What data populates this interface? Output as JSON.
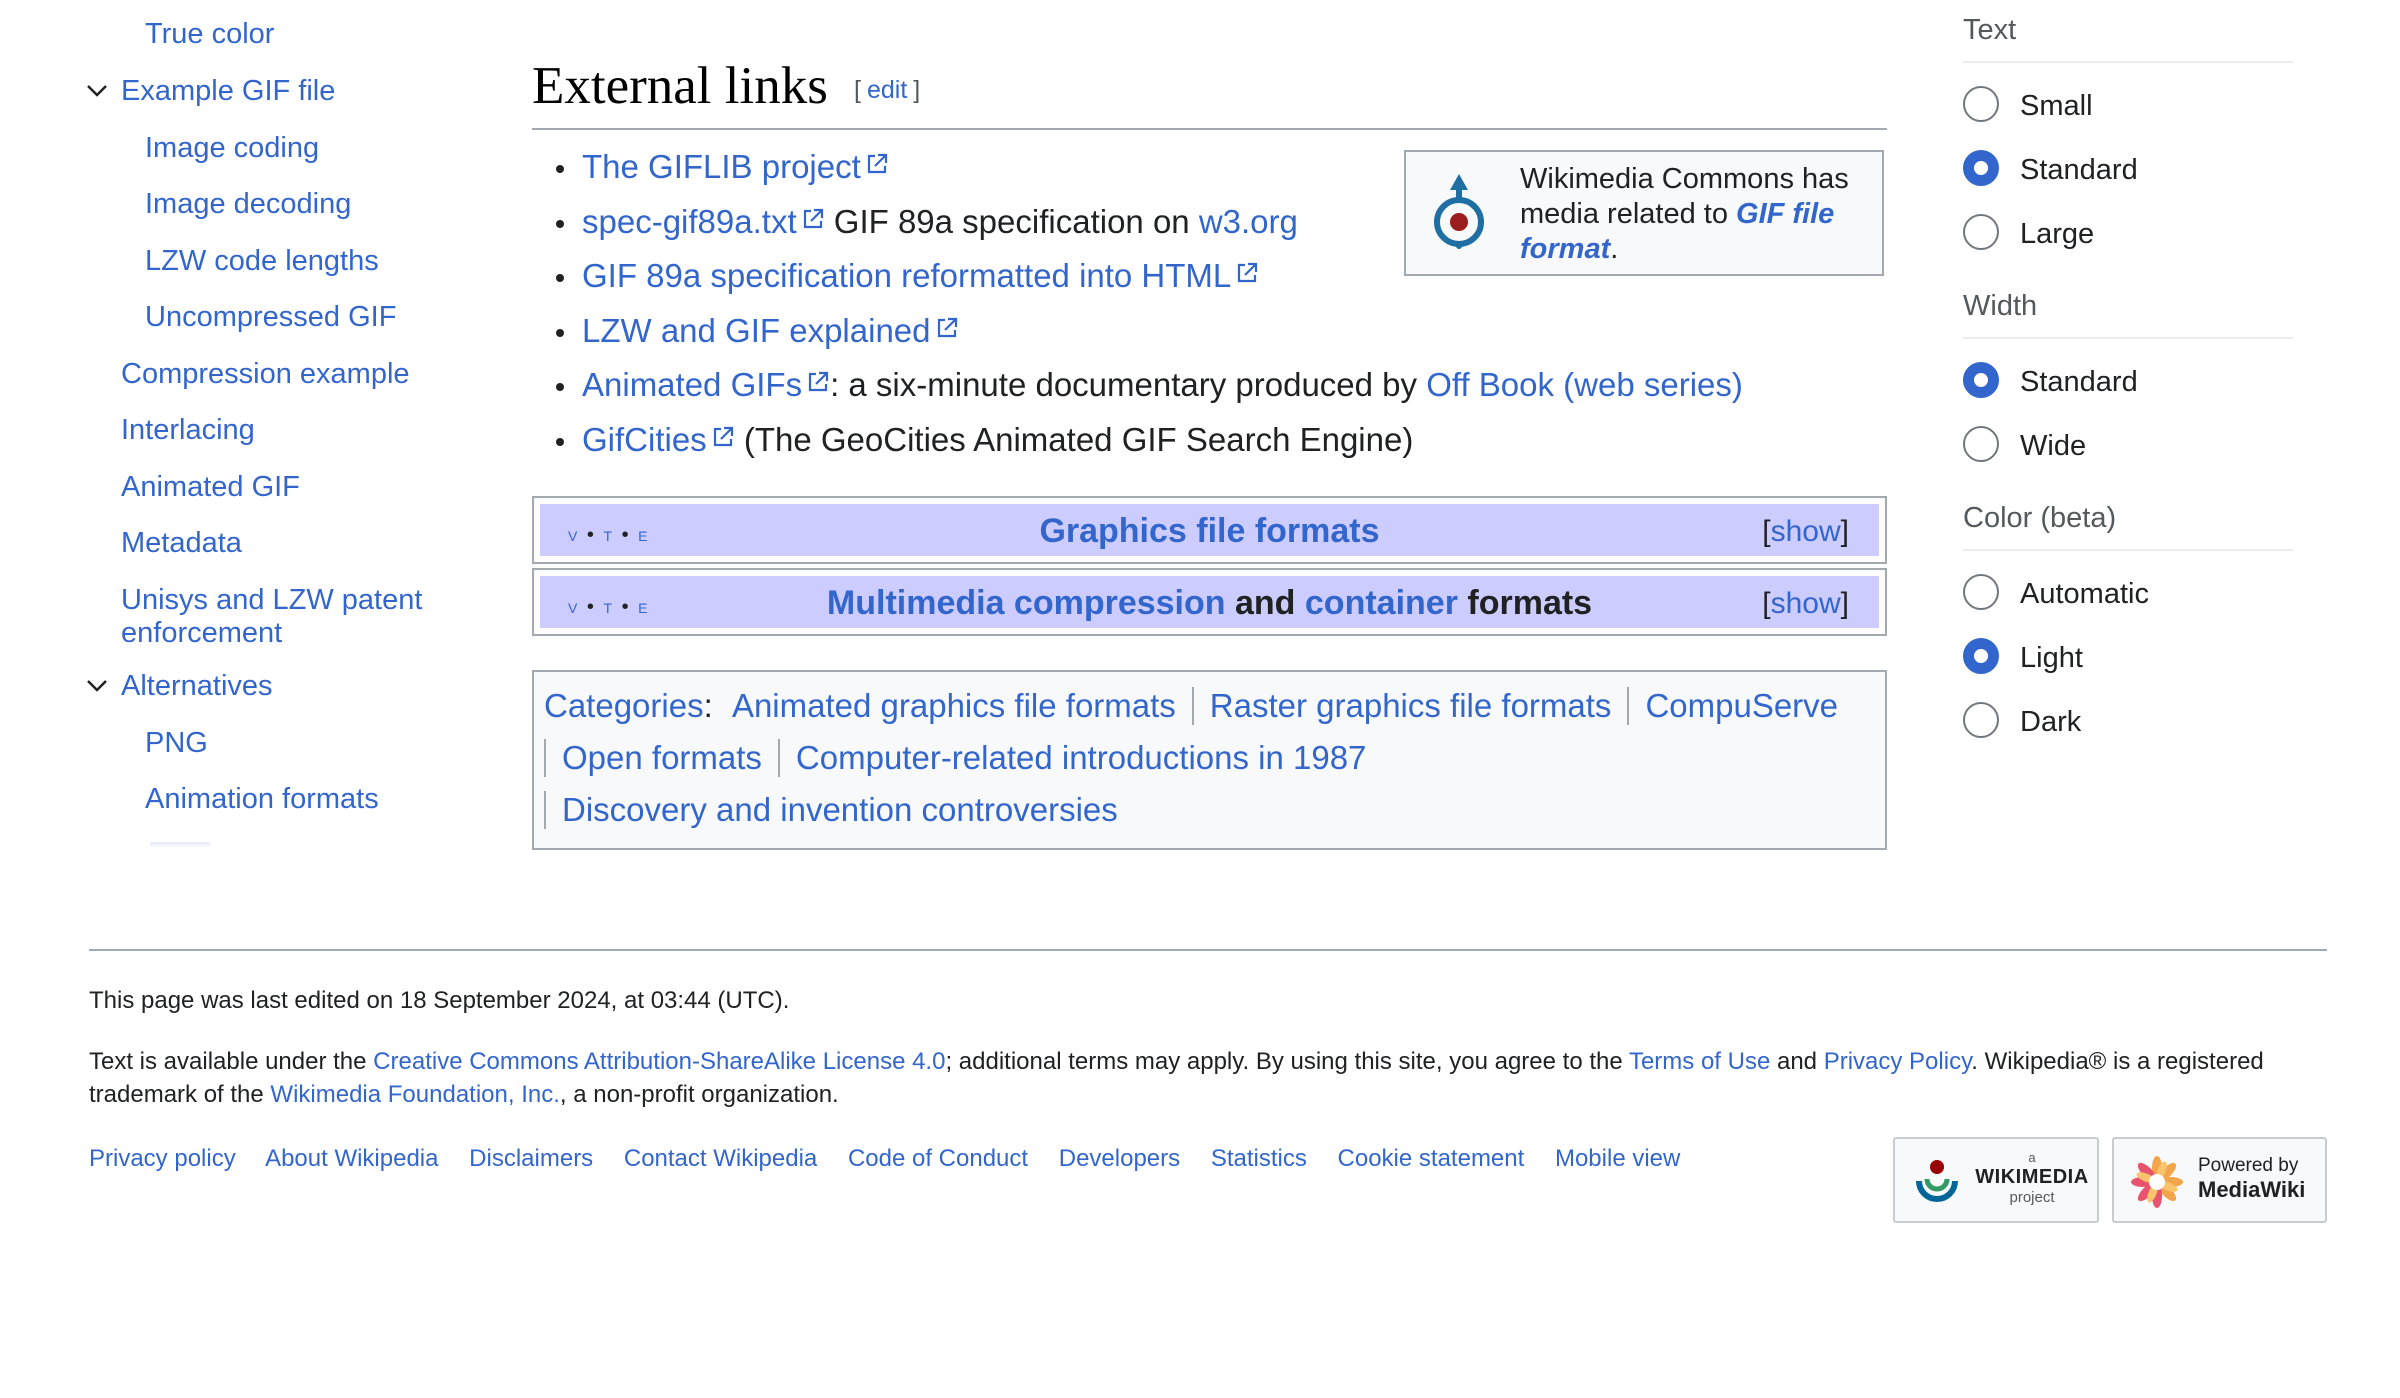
{
  "toc": {
    "items": [
      {
        "label": "True color",
        "level": 2
      },
      {
        "label": "Example GIF file",
        "level": 1,
        "expanded": true
      },
      {
        "label": "Image coding",
        "level": 2
      },
      {
        "label": "Image decoding",
        "level": 2
      },
      {
        "label": "LZW code lengths",
        "level": 2
      },
      {
        "label": "Uncompressed GIF",
        "level": 2
      },
      {
        "label": "Compression example",
        "level": 1
      },
      {
        "label": "Interlacing",
        "level": 1
      },
      {
        "label": "Animated GIF",
        "level": 1
      },
      {
        "label": "Metadata",
        "level": 1
      },
      {
        "label": "Unisys and LZW patent enforcement",
        "level": 1
      },
      {
        "label": "Alternatives",
        "level": 1,
        "expanded": true
      },
      {
        "label": "PNG",
        "level": 2
      },
      {
        "label": "Animation formats",
        "level": 2
      }
    ]
  },
  "section": {
    "title": "External links",
    "edit_label": "edit",
    "edit_open": "[",
    "edit_close": "]"
  },
  "external_links": [
    {
      "link": "The GIFLIB project",
      "text": "",
      "link2": ""
    },
    {
      "link": "spec-gif89a.txt",
      "text": " GIF 89a specification on ",
      "link2": "w3.org"
    },
    {
      "link": "GIF 89a specification reformatted into HTML",
      "text": "",
      "link2": ""
    },
    {
      "link": "LZW and GIF explained",
      "text": "",
      "link2": ""
    },
    {
      "link": "Animated GIFs",
      "text": ": a six-minute documentary produced by ",
      "link2": "Off Book (web series)"
    },
    {
      "link": "GifCities",
      "text": " (The GeoCities Animated GIF Search Engine)",
      "link2": ""
    }
  ],
  "commons": {
    "text": "Wikimedia Commons has media related to ",
    "link": "GIF file format",
    "end": "."
  },
  "navboxes": [
    {
      "vte": [
        "v",
        "t",
        "e"
      ],
      "title_link1": "Graphics file formats",
      "title_mid": "",
      "title_link2": "",
      "title_end": "",
      "show": "show"
    },
    {
      "vte": [
        "v",
        "t",
        "e"
      ],
      "title_link1": "Multimedia compression",
      "title_mid": " and ",
      "title_link2": "container",
      "title_end": " formats",
      "show": "show"
    }
  ],
  "categories": {
    "label": "Categories",
    "items": [
      "Animated graphics file formats",
      "Raster graphics file formats",
      "CompuServe",
      "Open formats",
      "Computer-related introductions in 1987",
      "Discovery and invention controversies"
    ]
  },
  "appearance": {
    "text": {
      "heading": "Text",
      "options": [
        "Small",
        "Standard",
        "Large"
      ],
      "selected": "Standard"
    },
    "width": {
      "heading": "Width",
      "options": [
        "Standard",
        "Wide"
      ],
      "selected": "Standard"
    },
    "color": {
      "heading": "Color (beta)",
      "options": [
        "Automatic",
        "Light",
        "Dark"
      ],
      "selected": "Light"
    }
  },
  "footer": {
    "last_edited": "This page was last edited on 18 September 2024, at 03:44 (UTC).",
    "license": {
      "t1": "Text is available under the ",
      "l1": "Creative Commons Attribution-ShareAlike License 4.0",
      "t2": "; additional terms may apply. By using this site, you agree to the ",
      "l2": "Terms of Use",
      "t3": " and ",
      "l3": "Privacy Policy",
      "t4": ". Wikipedia® is a registered trademark of the ",
      "l4": "Wikimedia Foundation, Inc.",
      "t5": ", a non-profit organization."
    },
    "links": [
      "Privacy policy",
      "About Wikipedia",
      "Disclaimers",
      "Contact Wikipedia",
      "Code of Conduct",
      "Developers",
      "Statistics",
      "Cookie statement",
      "Mobile view"
    ],
    "wikimedia_badge": {
      "a": "a",
      "name": "WIKIMEDIA",
      "project": "project"
    },
    "mediawiki_badge": {
      "line1": "Powered by",
      "line2": "MediaWiki"
    }
  },
  "colors": {
    "link": "#3366cc",
    "navbox_title_bg": "#ccccff",
    "radio_selected": "#3366cc",
    "border": "#a2a9b1"
  },
  "icons": [
    "chevron-down-icon",
    "external-link-icon",
    "commons-logo-icon",
    "wikimedia-logo-icon",
    "mediawiki-logo-icon"
  ]
}
